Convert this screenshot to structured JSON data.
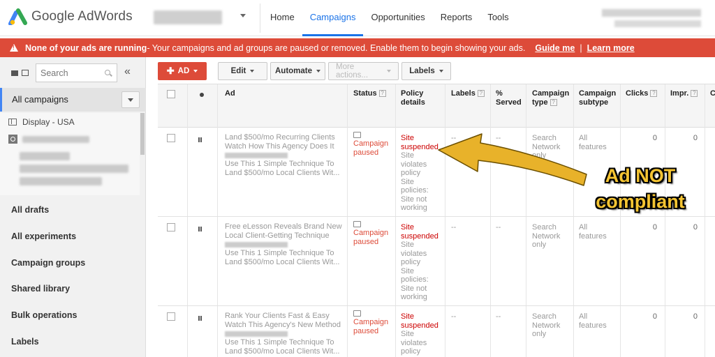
{
  "app": {
    "title": "Google AdWords",
    "nav": [
      "Home",
      "Campaigns",
      "Opportunities",
      "Reports",
      "Tools"
    ],
    "active_nav": "Campaigns"
  },
  "alert": {
    "bold": "None of your ads are running",
    "text": " - Your campaigns and ad groups are paused or removed. Enable them to begin showing your ads.",
    "guide_link": "Guide me",
    "learn_link": "Learn more",
    "color": "#dd4b39"
  },
  "sidebar": {
    "search_placeholder": "Search",
    "all_campaigns": "All campaigns",
    "tree_item": "Display - USA",
    "links": [
      "All drafts",
      "All experiments",
      "Campaign groups",
      "Shared library",
      "Bulk operations",
      "Labels"
    ]
  },
  "toolbar": {
    "ad_label": "AD",
    "edit_label": "Edit",
    "automate_label": "Automate",
    "more_label": "More actions...",
    "labels_label": "Labels"
  },
  "table": {
    "headers": {
      "ad": "Ad",
      "status": "Status",
      "policy": "Policy details",
      "labels": "Labels",
      "served": "% Served",
      "ctype": "Campaign type",
      "csub": "Campaign subtype",
      "clicks": "Clicks",
      "impr": "Impr.",
      "c": "C"
    },
    "rows": [
      {
        "line1": "Land $500/mo Recurring Clients",
        "line2": "Watch How This Agency Does It",
        "line4": "Use This 1 Simple Technique To",
        "line5": "Land $500/mo Local Clients Wit...",
        "status1": "Campaign",
        "status2": "paused",
        "policy_red1": "Site",
        "policy_red2": "suspended",
        "policy_rest": [
          "Site",
          "violates",
          "policy",
          "Site",
          "policies:",
          "Site not",
          "working"
        ],
        "labels": "--",
        "served": "--",
        "ctype": [
          "Search",
          "Network",
          "only"
        ],
        "csub": [
          "All",
          "features"
        ],
        "clicks": "0",
        "impr": "0"
      },
      {
        "line1": "Free eLesson Reveals Brand New",
        "line2": "Local Client-Getting Technique",
        "line4": "Use This 1 Simple Technique To",
        "line5": "Land $500/mo Local Clients Wit...",
        "status1": "Campaign",
        "status2": "paused",
        "policy_red1": "Site",
        "policy_red2": "suspended",
        "policy_rest": [
          "Site",
          "violates",
          "policy",
          "Site",
          "policies:",
          "Site not",
          "working"
        ],
        "labels": "--",
        "served": "--",
        "ctype": [
          "Search",
          "Network",
          "only"
        ],
        "csub": [
          "All",
          "features"
        ],
        "clicks": "0",
        "impr": "0"
      },
      {
        "line1": "Rank Your Clients Fast & Easy",
        "line2": "Watch This Agency's New Method",
        "line4": "Use This 1 Simple Technique To",
        "line5": "Land $500/mo Local Clients Wit...",
        "status1": "Campaign",
        "status2": "paused",
        "policy_red1": "Site",
        "policy_red2": "suspended",
        "policy_rest": [
          "Site",
          "violates",
          "policy"
        ],
        "labels": "--",
        "served": "--",
        "ctype": [
          "Search",
          "Network",
          "only"
        ],
        "csub": [
          "All",
          "features"
        ],
        "clicks": "0",
        "impr": "0"
      }
    ]
  },
  "annotation": {
    "line1": "Ad NOT",
    "line2": "compliant",
    "color": "#f4c432"
  }
}
